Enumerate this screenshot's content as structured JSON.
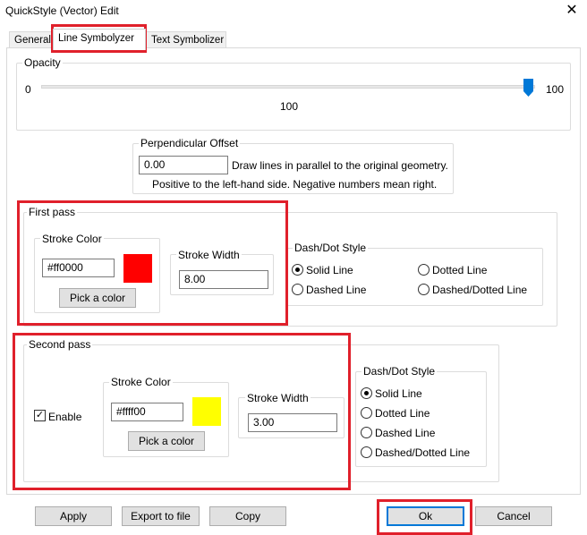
{
  "window": {
    "title": "QuickStyle (Vector) Edit",
    "close_glyph": "✕"
  },
  "tabs": [
    {
      "label": "General"
    },
    {
      "label": "Line Symbolyzer"
    },
    {
      "label": "Text Symbolizer"
    }
  ],
  "opacity": {
    "label": "Opacity",
    "min_label": "0",
    "max_label": "100",
    "value_label": "100",
    "value": 100
  },
  "offset": {
    "label": "Perpendicular Offset",
    "value": "0.00",
    "hint1": "Draw lines in parallel to the original geometry.",
    "hint2": "Positive to the left-hand side. Negative numbers mean right."
  },
  "first_pass": {
    "label": "First pass",
    "stroke_color_label": "Stroke Color",
    "color_value": "#ff0000",
    "swatch_color": "#ff0000",
    "pick_label": "Pick a color",
    "stroke_width_label": "Stroke Width",
    "width_value": "8.00",
    "dash_label": "Dash/Dot Style",
    "styles": {
      "solid": "Solid Line",
      "dotted": "Dotted Line",
      "dashed": "Dashed Line",
      "dashdot": "Dashed/Dotted Line"
    }
  },
  "second_pass": {
    "label": "Second pass",
    "enable_label": "Enable",
    "stroke_color_label": "Stroke Color",
    "color_value": "#ffff00",
    "swatch_color": "#ffff00",
    "pick_label": "Pick a color",
    "stroke_width_label": "Stroke Width",
    "width_value": "3.00",
    "dash_label": "Dash/Dot Style",
    "styles": {
      "solid": "Solid Line",
      "dotted": "Dotted Line",
      "dashed": "Dashed Line",
      "dashdot": "Dashed/Dotted Line"
    }
  },
  "buttons": {
    "apply": "Apply",
    "export": "Export to file",
    "copy": "Copy",
    "ok": "Ok",
    "cancel": "Cancel"
  },
  "colors": {
    "accent": "#0078d7",
    "highlight": "#e0202b"
  }
}
